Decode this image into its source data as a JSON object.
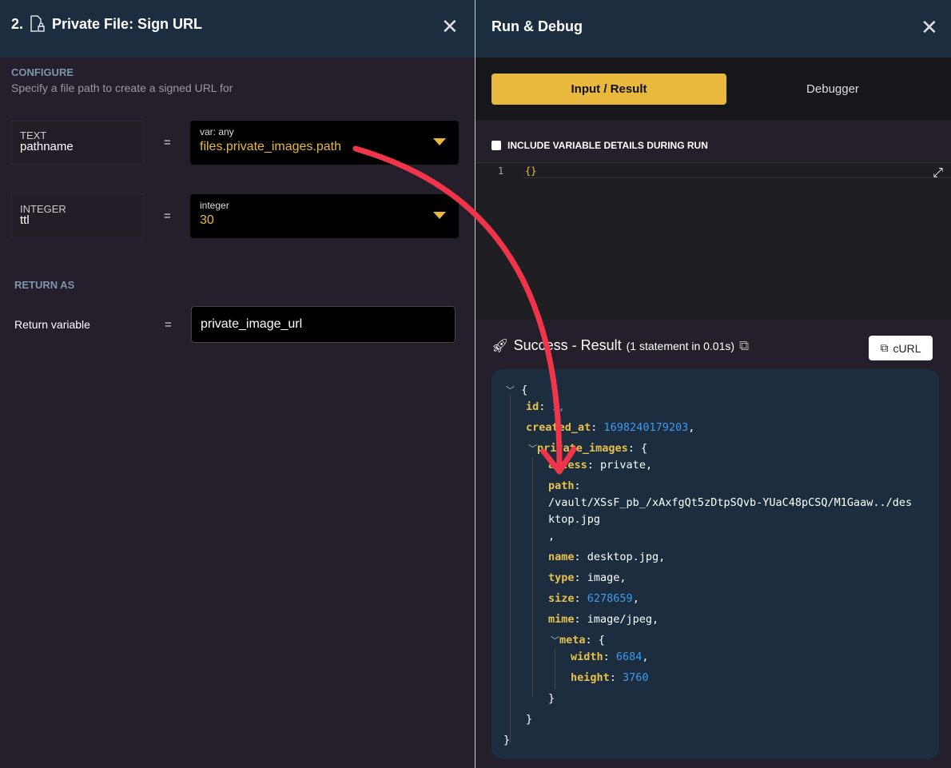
{
  "left": {
    "step": "2.",
    "title": "Private File: Sign URL",
    "configure": "CONFIGURE",
    "subtitle": "Specify a file path to create a signed URL for",
    "params": [
      {
        "type": "TEXT",
        "name": "pathname",
        "eq": "=",
        "value_type": "var: any",
        "value": "files.private_images.path"
      },
      {
        "type": "INTEGER",
        "name": "ttl",
        "eq": "=",
        "value_type": "integer",
        "value": "30"
      }
    ],
    "return_as": "RETURN AS",
    "return_label": "Return variable",
    "return_eq": "=",
    "return_value": "private_image_url"
  },
  "right": {
    "title": "Run & Debug",
    "tabs": [
      {
        "label": "Input / Result",
        "active": true
      },
      {
        "label": "Debugger",
        "active": false
      }
    ],
    "checkbox_label": "INCLUDE VARIABLE DETAILS DURING RUN",
    "checkbox_checked": false,
    "editor": {
      "line": "1",
      "code": "{}"
    },
    "result": {
      "title": "Success - Result",
      "detail": "(1 statement in 0.01s)",
      "curl": "cURL",
      "json": {
        "open": "{",
        "close": "}",
        "id_key": "id",
        "id_val": "1,",
        "created_key": "created_at",
        "created_val": "1698240179203",
        "pi_key": "private_images",
        "access_key": "access",
        "access_val": "private,",
        "path_key": "path",
        "path_val1": "/vault/XSsF_pb_/xAxfgQt5zDtpSQvb-YUaC48pCSQ/M1Gaaw../des",
        "path_val2": "ktop.jpg",
        "path_comma": ",",
        "name_key": "name",
        "name_val": "desktop.jpg,",
        "type_key": "type",
        "type_val": "image,",
        "size_key": "size",
        "size_val": "6278659",
        "mime_key": "mime",
        "mime_val": "image/jpeg,",
        "meta_key": "meta",
        "width_key": "width",
        "width_val": "6684",
        "height_key": "height",
        "height_val": "3760"
      }
    }
  },
  "colors": {
    "accent": "#e8b93c",
    "header": "#1b2d3f",
    "arrow": "#f0354a"
  }
}
